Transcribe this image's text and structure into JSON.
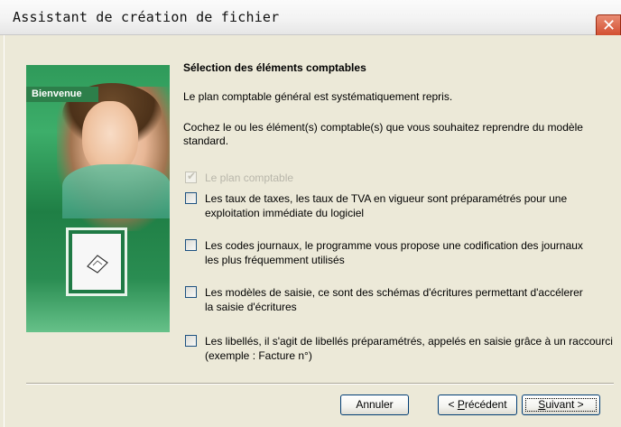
{
  "window": {
    "title": "Assistant de création de fichier",
    "close_label": "✕"
  },
  "banner": {
    "label": "Bienvenue"
  },
  "content": {
    "heading": "Sélection des éléments comptables",
    "para1": "Le plan comptable général est systématiquement repris.",
    "para2": "Cochez le ou les élément(s) comptable(s) que vous souhaitez reprendre du modèle standard.",
    "options": [
      {
        "label": "Le plan comptable",
        "checked": true,
        "disabled": true
      },
      {
        "label": "Les taux de taxes, les taux de TVA en vigueur sont préparamétrés pour une exploitation immédiate du logiciel",
        "checked": false,
        "disabled": false
      },
      {
        "label": "Les codes journaux, le programme vous propose une codification des journaux les plus fréquemment utilisés",
        "checked": false,
        "disabled": false
      },
      {
        "label": "Les modèles de saisie, ce sont des schémas d'écritures permettant d'accélerer la saisie d'écritures",
        "checked": false,
        "disabled": false
      },
      {
        "label": "Les libellés, il s'agit de libellés préparamétrés, appelés en saisie grâce à un raccourci (exemple : Facture n°)",
        "checked": false,
        "disabled": false
      }
    ]
  },
  "buttons": {
    "cancel": "Annuler",
    "previous_prefix": "< ",
    "previous_mnemonic": "P",
    "previous_rest": "récédent",
    "next_mnemonic": "S",
    "next_rest": "uivant >"
  }
}
